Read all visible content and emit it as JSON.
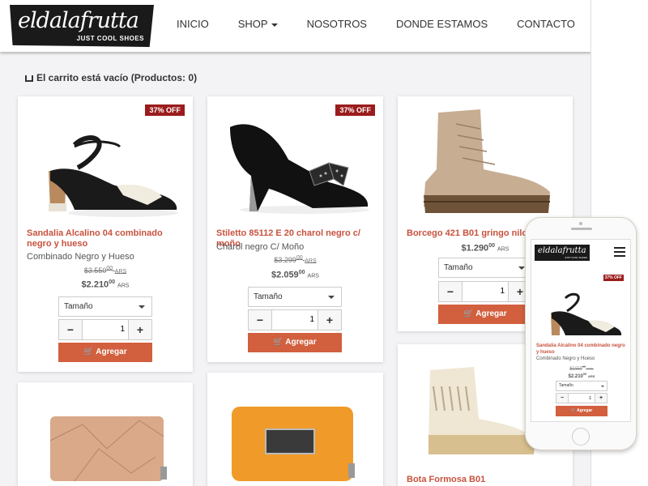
{
  "brand": {
    "script": "eldalafrutta",
    "tagline": "JUST COOL SHOES"
  },
  "nav": {
    "items": [
      "INICIO",
      "SHOP",
      "NOSOTROS",
      "DONDE ESTAMOS",
      "CONTACTO"
    ]
  },
  "cart": {
    "text": "El carrito está vacío (Productos: 0)"
  },
  "products": [
    {
      "badge": "37% OFF",
      "name": "Sandalia Alcalino 04 combinado negro y hueso",
      "desc": "Combinado Negro y Hueso",
      "old_price": "$3.550",
      "old_cents": "00",
      "price": "$2.210",
      "price_cents": "00",
      "currency": "ARS",
      "size_label": "Tamaño",
      "qty": "1",
      "add": "Agregar"
    },
    {
      "badge": "37% OFF",
      "name": "Stiletto 85112 E 20 charol negro c/ moño",
      "desc": "Charol negro C/ Moño",
      "old_price": "$3.299",
      "old_cents": "00",
      "price": "$2.059",
      "price_cents": "00",
      "currency": "ARS",
      "size_label": "Tamaño",
      "qty": "1",
      "add": "Agregar"
    },
    {
      "name": "Borcego 421 B01 gringo nilo c/ h",
      "price": "$1.290",
      "price_cents": "00",
      "currency": "ARS",
      "size_label": "Tamaño",
      "qty": "1",
      "add": "Agregar"
    },
    {
      "name": "Bota Formosa B01"
    }
  ],
  "mobile": {
    "brand_script": "eldalafrutta",
    "tagline": "JUST COOL SHOES",
    "badge": "37% OFF",
    "name": "Sandalia Alcalino 04 combinado negro y hueso",
    "desc": "Combinado Negro y Hueso",
    "old_price": "$3.550",
    "old_cents": "00",
    "price": "$2.210",
    "price_cents": "00",
    "currency": "ARS",
    "size_label": "Tamaño",
    "qty": "1",
    "add": "Agregar"
  },
  "colors": {
    "accent": "#d2603f",
    "badge": "#9b1c1c",
    "title": "#c8523d"
  },
  "stepper": {
    "minus": "−",
    "plus": "+"
  }
}
